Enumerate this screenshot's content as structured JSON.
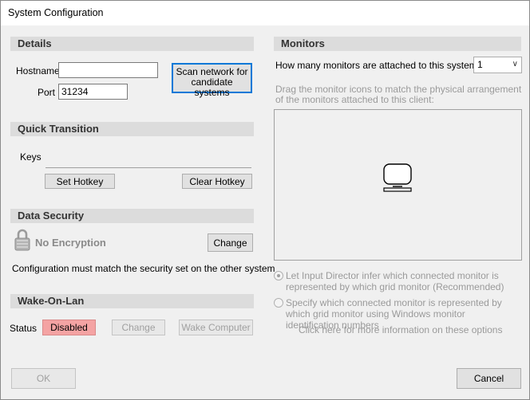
{
  "window": {
    "title": "System Configuration"
  },
  "details": {
    "header": "Details",
    "hostname_label": "Hostname",
    "hostname_value": "",
    "port_label": "Port",
    "port_value": "31234",
    "scan_button": "Scan network for candidate systems"
  },
  "quick_transition": {
    "header": "Quick Transition",
    "keys_label": "Keys",
    "set_hotkey": "Set Hotkey",
    "clear_hotkey": "Clear Hotkey"
  },
  "data_security": {
    "header": "Data Security",
    "encryption_status": "No Encryption",
    "change_button": "Change",
    "note": "Configuration must match the security set on the other system"
  },
  "wake_on_lan": {
    "header": "Wake-On-Lan",
    "status_label": "Status",
    "status_value": "Disabled",
    "status_color": "#f4a3a3",
    "change_button": "Change",
    "wake_button": "Wake Computer"
  },
  "monitors": {
    "header": "Monitors",
    "count_label": "How many monitors are attached to this system",
    "count_value": "1",
    "instructions": "Drag the monitor icons to match the physical arrangement of the monitors attached to this client:",
    "option_infer": "Let Input Director infer which connected monitor is represented by which grid monitor (Recommended)",
    "option_specify": "Specify which connected monitor is represented by which grid monitor using Windows monitor identification numbers",
    "more_info_link": "Click here for more information on these options"
  },
  "footer": {
    "ok": "OK",
    "cancel": "Cancel"
  },
  "colors": {
    "accent": "#0078d7",
    "header_bg": "#dcdcdc",
    "window_bg": "#f0f0f0"
  }
}
